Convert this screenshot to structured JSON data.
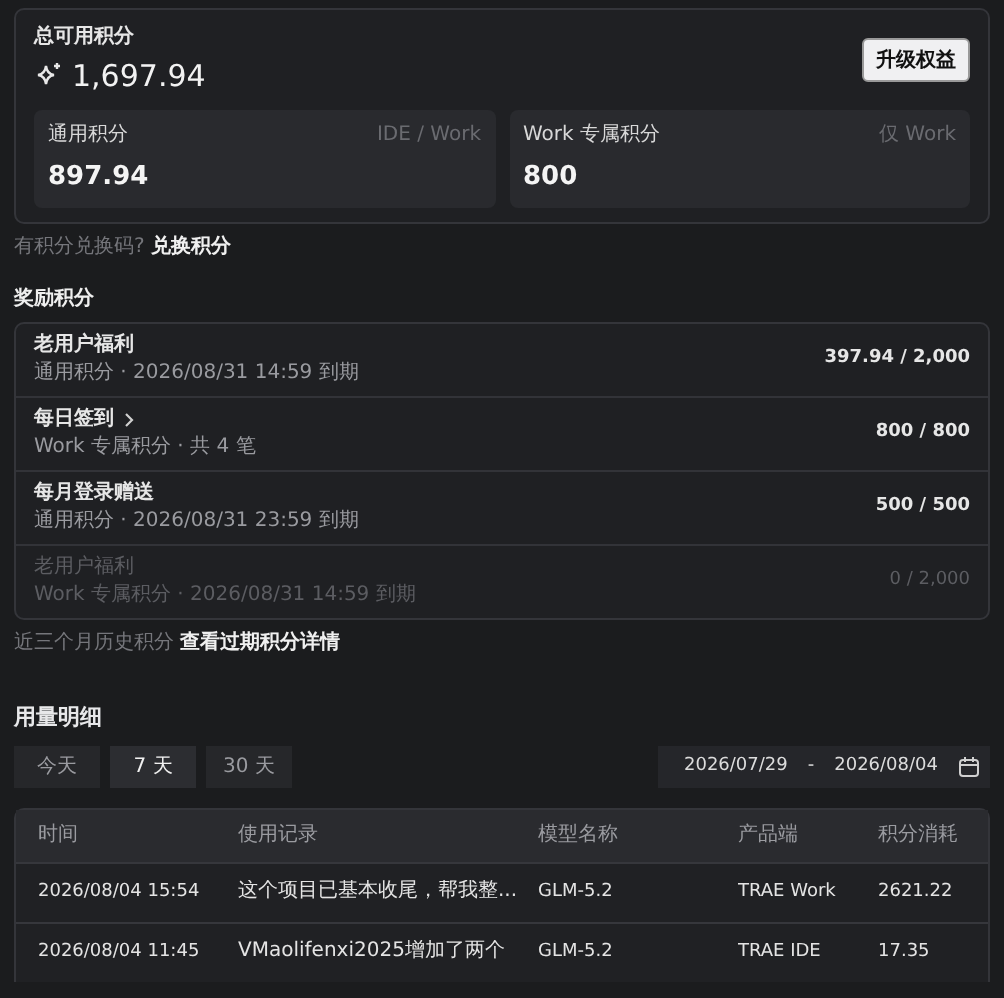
{
  "total": {
    "title": "总可用积分",
    "value": "1,697.94",
    "upgrade_button": "升级权益",
    "balances": [
      {
        "name": "通用积分",
        "scope": "IDE / Work",
        "value": "897.94"
      },
      {
        "name": "Work 专属积分",
        "scope": "仅 Work",
        "value": "800"
      }
    ]
  },
  "redeem": {
    "prompt": "有积分兑换码?",
    "link": "兑换积分"
  },
  "rewards": {
    "title": "奖励积分",
    "items": [
      {
        "name": "老用户福利",
        "detail": "通用积分 · 2026/08/31 14:59 到期",
        "amount": "397.94 / 2,000",
        "disabled": false,
        "chevron": false
      },
      {
        "name": "每日签到",
        "detail": "Work 专属积分 · 共 4 笔",
        "amount": "800 / 800",
        "disabled": false,
        "chevron": true
      },
      {
        "name": "每月登录赠送",
        "detail": "通用积分 · 2026/08/31 23:59 到期",
        "amount": "500 / 500",
        "disabled": false,
        "chevron": false
      },
      {
        "name": "老用户福利",
        "detail": "Work 专属积分 · 2026/08/31 14:59 到期",
        "amount": "0 / 2,000",
        "disabled": true,
        "chevron": false
      }
    ],
    "history_prompt": "近三个月历史积分",
    "history_link": "查看过期积分详情"
  },
  "usage": {
    "title": "用量明细",
    "ranges": [
      {
        "label": "今天",
        "selected": false
      },
      {
        "label": "7 天",
        "selected": true
      },
      {
        "label": "30 天",
        "selected": false
      }
    ],
    "date_from": "2026/07/29",
    "date_separator": "-",
    "date_to": "2026/08/04",
    "table": {
      "columns": [
        "时间",
        "使用记录",
        "模型名称",
        "产品端",
        "积分消耗"
      ],
      "rows": [
        [
          "2026/08/04 15:54",
          "这个项目已基本收尾，帮我整...",
          "GLM-5.2",
          "TRAE Work",
          "2621.22"
        ],
        [
          "2026/08/04 11:45",
          "VMaolifenxi2025增加了两个",
          "GLM-5.2",
          "TRAE IDE",
          "17.35"
        ]
      ]
    }
  }
}
